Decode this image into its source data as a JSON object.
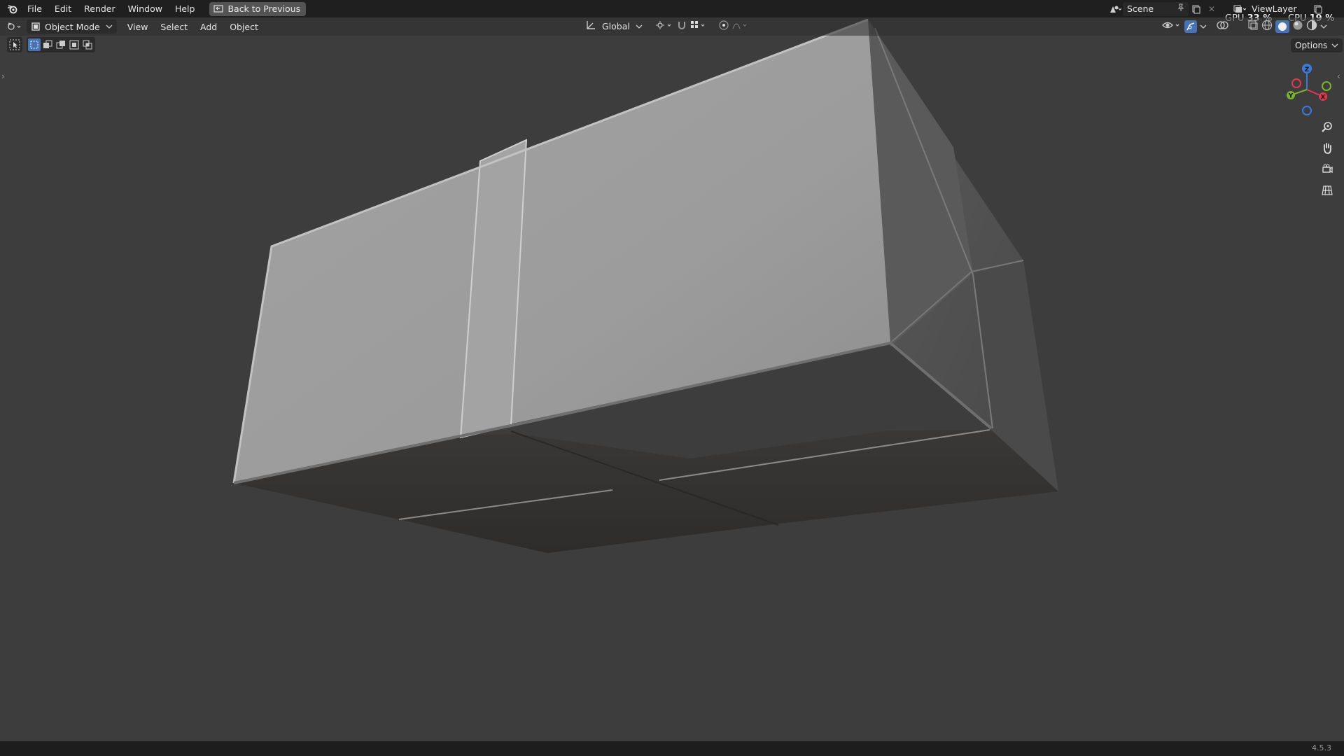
{
  "menubar": {
    "items": [
      "File",
      "Edit",
      "Render",
      "Window",
      "Help"
    ],
    "back_button": "Back to Previous",
    "scene_name": "Scene",
    "view_layer": "ViewLayer"
  },
  "performance": {
    "gpu_label": "GPU",
    "gpu_value": "33 %",
    "cpu_label": "CPU",
    "cpu_value": "19 %"
  },
  "viewport_header": {
    "mode": "Object Mode",
    "menus": [
      "View",
      "Select",
      "Add",
      "Object"
    ],
    "transform_orientation": "Global",
    "options_label": "Options"
  },
  "gizmo": {
    "x_label": "X",
    "y_label": "Y",
    "z_label": "Z",
    "x_color": "#e0394e",
    "y_color": "#7bb32e",
    "z_color": "#3b7ad9"
  },
  "statusbar": {
    "version": "4.5.3"
  },
  "colors": {
    "viewport_bg": "#3d3d3d",
    "topbar_bg": "#1f1f1f",
    "accent_blue": "#4772b3"
  }
}
